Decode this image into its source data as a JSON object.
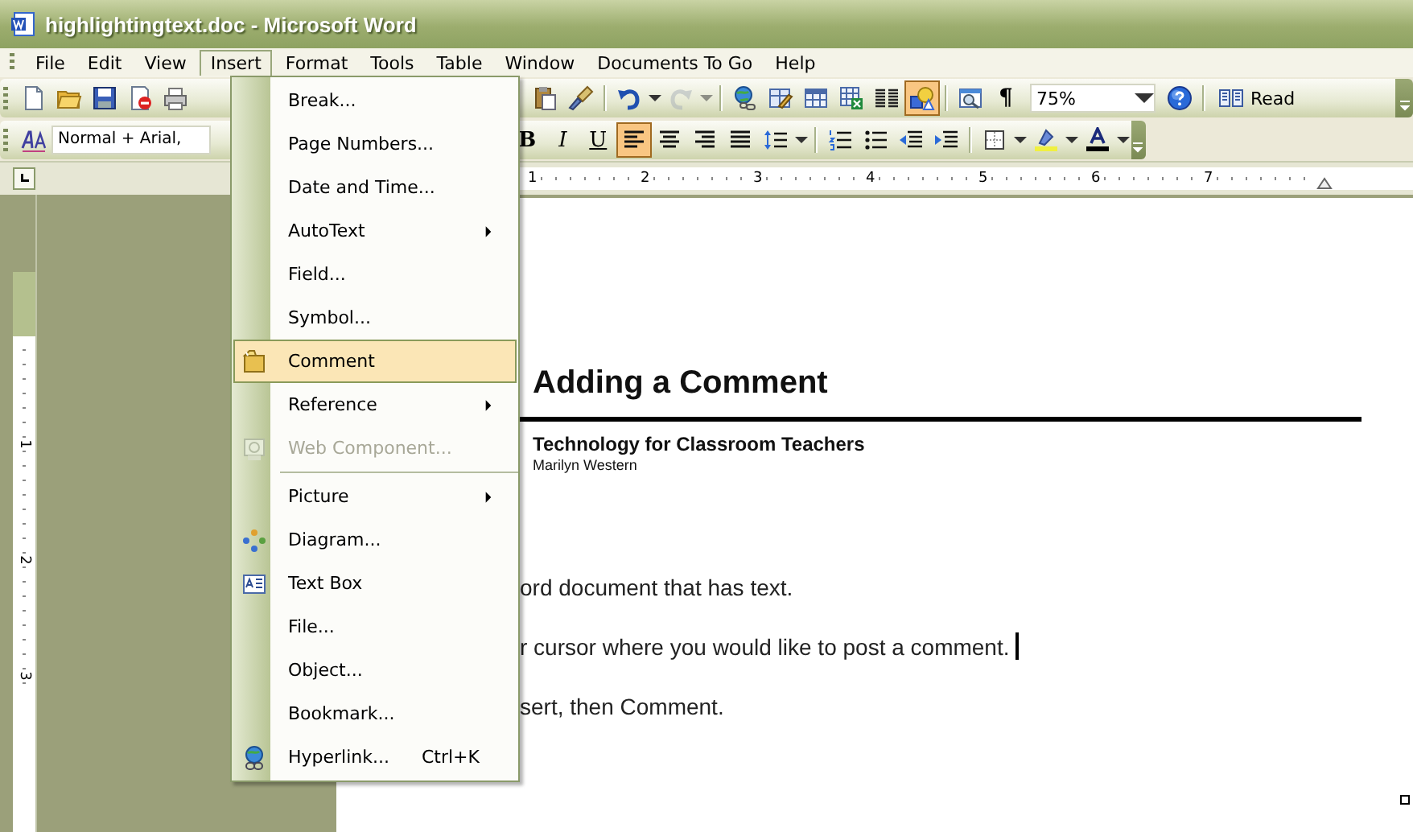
{
  "window": {
    "title": "highlightingtext.doc - Microsoft Word"
  },
  "menu_bar": [
    {
      "label": "File",
      "selected": false
    },
    {
      "label": "Edit",
      "selected": false
    },
    {
      "label": "View",
      "selected": false
    },
    {
      "label": "Insert",
      "selected": true
    },
    {
      "label": "Format",
      "selected": false
    },
    {
      "label": "Tools",
      "selected": false
    },
    {
      "label": "Table",
      "selected": false
    },
    {
      "label": "Window",
      "selected": false
    },
    {
      "label": "Documents To Go",
      "selected": false
    },
    {
      "label": "Help",
      "selected": false
    }
  ],
  "standard_toolbar": {
    "left": [
      {
        "kind": "new",
        "pressed": false
      },
      {
        "kind": "open",
        "pressed": false
      },
      {
        "kind": "save",
        "pressed": false
      },
      {
        "kind": "permission",
        "pressed": false
      },
      {
        "kind": "print",
        "pressed": false
      }
    ],
    "right": [
      {
        "kind": "paste",
        "pressed": false
      },
      {
        "kind": "painter",
        "pressed": false
      },
      {
        "kind": "separator"
      },
      {
        "kind": "undo",
        "pressed": false
      },
      {
        "kind": "caret",
        "pressed": false
      },
      {
        "kind": "redo",
        "pressed": false,
        "disabled": true
      },
      {
        "kind": "caret",
        "pressed": false,
        "disabled": true
      },
      {
        "kind": "separator"
      },
      {
        "kind": "hyperlink",
        "pressed": false
      },
      {
        "kind": "tables",
        "pressed": false
      },
      {
        "kind": "table",
        "pressed": false
      },
      {
        "kind": "sheet",
        "pressed": false
      },
      {
        "kind": "columns",
        "pressed": false
      },
      {
        "kind": "drawing",
        "pressed": true
      },
      {
        "kind": "separator"
      },
      {
        "kind": "docmap",
        "pressed": false
      },
      {
        "kind": "text",
        "label": "¶",
        "pressed": false
      }
    ],
    "zoom": "75%",
    "read_button": {
      "label": "Read"
    }
  },
  "formatting_toolbar": {
    "style": "Normal + Arial,",
    "buttons": [
      {
        "kind": "bold",
        "label": "B",
        "pressed": false
      },
      {
        "kind": "italic",
        "label": "I",
        "pressed": false
      },
      {
        "kind": "underline",
        "label": "U",
        "pressed": false
      },
      {
        "kind": "align-left",
        "pressed": true
      },
      {
        "kind": "align-center",
        "pressed": false
      },
      {
        "kind": "align-right",
        "pressed": false
      },
      {
        "kind": "justify",
        "pressed": false
      },
      {
        "kind": "spacing",
        "pressed": false
      },
      {
        "kind": "caret",
        "pressed": false
      },
      {
        "kind": "separator"
      },
      {
        "kind": "numbering",
        "pressed": false
      },
      {
        "kind": "bullets",
        "pressed": false
      },
      {
        "kind": "outdent",
        "pressed": false
      },
      {
        "kind": "indent",
        "pressed": false
      },
      {
        "kind": "separator"
      },
      {
        "kind": "border",
        "pressed": false
      },
      {
        "kind": "caret",
        "pressed": false
      },
      {
        "kind": "highlight",
        "pressed": false
      },
      {
        "kind": "caret",
        "pressed": false
      },
      {
        "kind": "fontcolor",
        "pressed": false
      },
      {
        "kind": "caret",
        "pressed": false
      }
    ]
  },
  "horizontal_ruler": {
    "numbers": [
      "1",
      "2",
      "3",
      "4",
      "5",
      "6",
      "7"
    ]
  },
  "vertical_ruler": {
    "numbers": [
      "1",
      "2",
      "3"
    ]
  },
  "insert_menu": [
    {
      "label": "Break...",
      "submenu": false,
      "selected": false,
      "disabled": false
    },
    {
      "label": "Page Numbers...",
      "submenu": false,
      "selected": false,
      "disabled": false
    },
    {
      "label": "Date and Time...",
      "submenu": false,
      "selected": false,
      "disabled": false
    },
    {
      "label": "AutoText",
      "submenu": true,
      "selected": false,
      "disabled": false
    },
    {
      "label": "Field...",
      "submenu": false,
      "selected": false,
      "disabled": false
    },
    {
      "label": "Symbol...",
      "submenu": false,
      "selected": false,
      "disabled": false
    },
    {
      "label": "Comment",
      "submenu": false,
      "selected": true,
      "disabled": false
    },
    {
      "label": "Reference",
      "submenu": true,
      "selected": false,
      "disabled": false
    },
    {
      "label": "Web Component...",
      "submenu": false,
      "selected": false,
      "disabled": true
    },
    {
      "label": "Picture",
      "submenu": true,
      "selected": false,
      "disabled": false,
      "separator_before": true
    },
    {
      "label": "Diagram...",
      "submenu": false,
      "selected": false,
      "disabled": false
    },
    {
      "label": "Text Box",
      "submenu": false,
      "selected": false,
      "disabled": false
    },
    {
      "label": "File...",
      "submenu": false,
      "selected": false,
      "disabled": false
    },
    {
      "label": "Object...",
      "submenu": false,
      "selected": false,
      "disabled": false
    },
    {
      "label": "Bookmark...",
      "submenu": false,
      "selected": false,
      "disabled": false
    },
    {
      "label": "Hyperlink...",
      "shortcut": "Ctrl+K",
      "submenu": false,
      "selected": false,
      "disabled": false
    }
  ],
  "document": {
    "heading": "Adding a Comment",
    "subtitle": "Technology for Classroom Teachers",
    "author": "Marilyn Western",
    "paragraphs": [
      {
        "text": "ord document that has text.",
        "caret": false
      },
      {
        "text": "r cursor where you would like to post a comment.",
        "caret": true
      },
      {
        "text": "sert, then Comment.",
        "caret": false
      }
    ]
  }
}
